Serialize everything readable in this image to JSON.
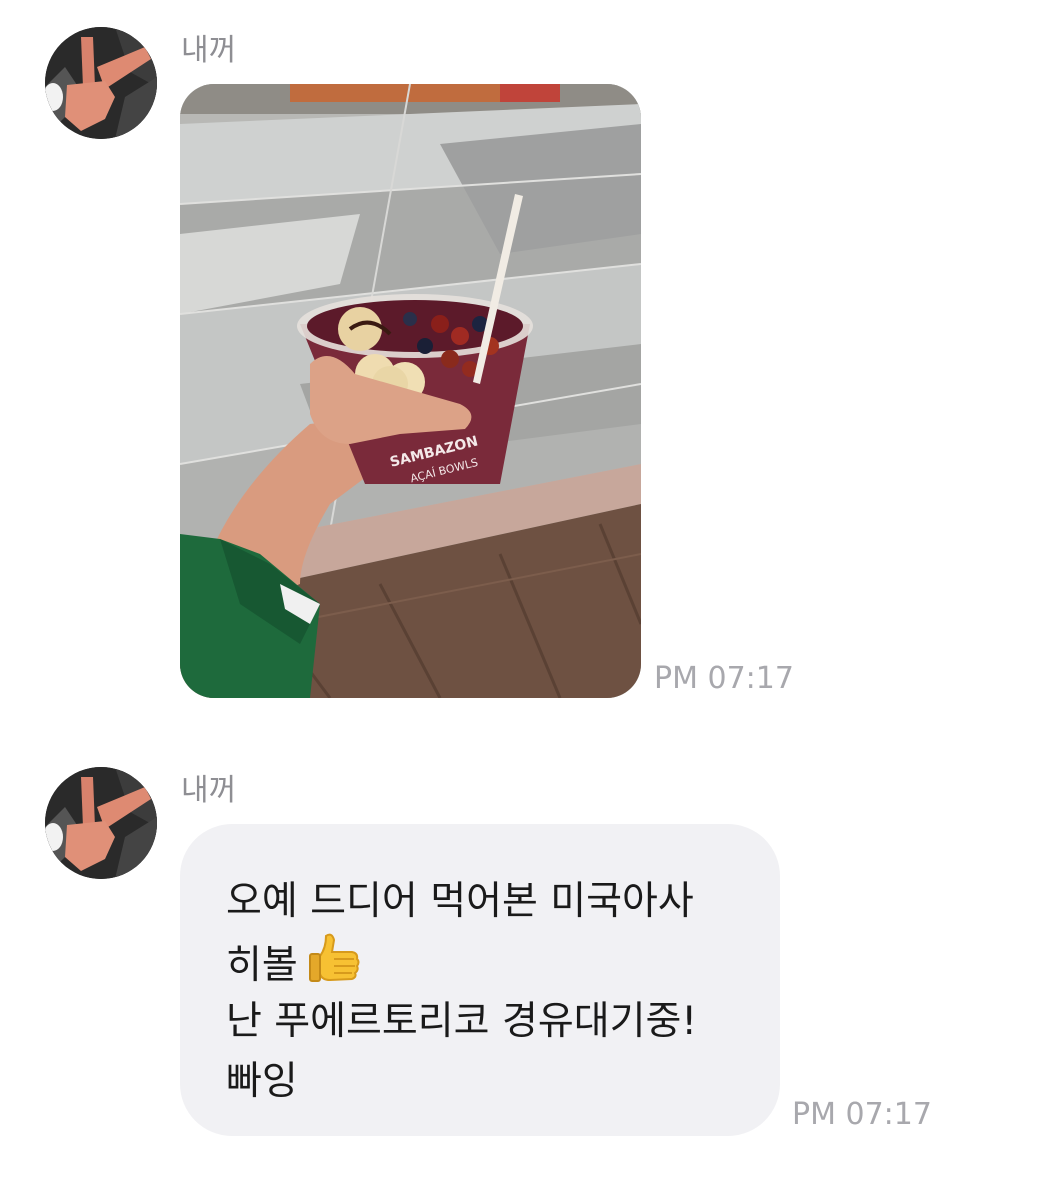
{
  "messages": [
    {
      "type": "image",
      "sender": "내꺼",
      "image": {
        "description": "hand holding an acai bowl cup with banana slices, berries and a wooden spoon above a tiled mall floor",
        "cup_brand": "SAMBAZON",
        "cup_subtitle": "AÇAÍ BOWLS"
      },
      "time": "PM 07:17"
    },
    {
      "type": "text",
      "sender": "내꺼",
      "lines": [
        "오예 드디어 먹어본 미국아사",
        "히볼",
        "난 푸에르토리코 경유대기중!",
        "빠잉"
      ],
      "emoji": "thumbs-up-icon",
      "time": "PM 07:17"
    }
  ],
  "colors": {
    "bubble": "#f1f1f4",
    "sender_text": "#8e8e93",
    "time_text": "#a8a8ad",
    "message_text": "#1a1a1a"
  }
}
